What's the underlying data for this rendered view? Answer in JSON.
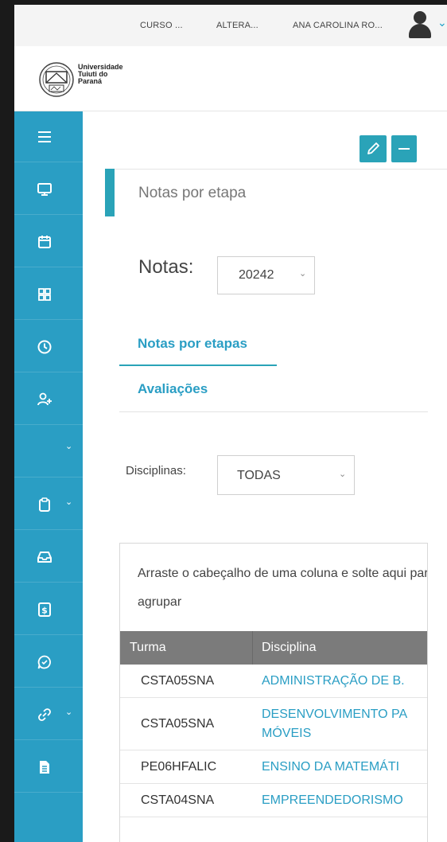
{
  "topbar": {
    "course": "CURSO ...",
    "alter": "ALTERA...",
    "user": "ANA CAROLINA RO..."
  },
  "logo": {
    "line1": "Universidade",
    "line2": "Tuiuti do",
    "line3": "Paraná"
  },
  "sidebar": {
    "items": [
      {
        "icon": "menu-icon"
      },
      {
        "icon": "monitor-icon"
      },
      {
        "icon": "calendar-icon"
      },
      {
        "icon": "grid-icon"
      },
      {
        "icon": "clock-icon"
      },
      {
        "icon": "add-user-icon"
      },
      {
        "icon": "chevron-down-icon"
      },
      {
        "icon": "clipboard-icon"
      },
      {
        "icon": "inbox-icon"
      },
      {
        "icon": "dollar-icon"
      },
      {
        "icon": "chat-icon"
      },
      {
        "icon": "link-icon"
      },
      {
        "icon": "document-icon"
      }
    ]
  },
  "section": {
    "title": "Notas por etapa"
  },
  "notas": {
    "label": "Notas:",
    "selected": "20242"
  },
  "tabs": {
    "items": [
      "Notas por etapas",
      "Avaliações"
    ]
  },
  "disciplinas": {
    "label": "Disciplinas:",
    "selected": "TODAS"
  },
  "grid": {
    "group_hint": "Arraste o cabeçalho de uma coluna e solte aqui para agrupar",
    "columns": [
      "Turma",
      "Disciplina"
    ],
    "rows": [
      {
        "turma": "CSTA05SNA",
        "disciplina": "ADMINISTRAÇÃO DE B."
      },
      {
        "turma": "CSTA05SNA",
        "disciplina_l1": "DESENVOLVIMENTO PA",
        "disciplina_l2": "MÓVEIS"
      },
      {
        "turma": "PE06HFALIC",
        "disciplina": "ENSINO DA MATEMÁTI"
      },
      {
        "turma": "CSTA04SNA",
        "disciplina": "EMPREENDEDORISMO"
      }
    ]
  },
  "colors": {
    "accent": "#2a9ec4",
    "sidebar": "#2a9ec4",
    "header_bg": "#7b7b7b"
  }
}
